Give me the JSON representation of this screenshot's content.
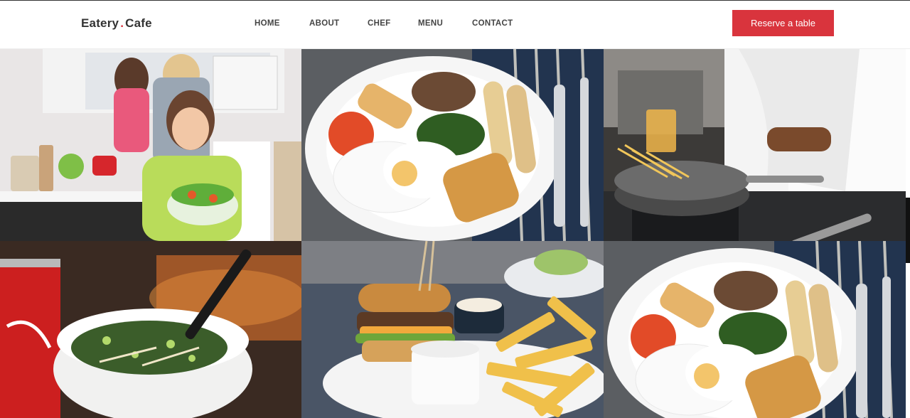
{
  "brand": {
    "name_part1": "Eatery",
    "separator": ".",
    "name_part2": "Cafe"
  },
  "nav": {
    "items": [
      {
        "label": "HOME"
      },
      {
        "label": "ABOUT"
      },
      {
        "label": "CHEF"
      },
      {
        "label": "MENU"
      },
      {
        "label": "CONTACT"
      }
    ],
    "reserve_label": "Reserve a table"
  },
  "colors": {
    "accent": "#d9343d",
    "nav_text": "#444444",
    "brand_text": "#333333"
  },
  "gallery": {
    "tiles": [
      {
        "subject": "family-kitchen-salad"
      },
      {
        "subject": "breakfast-plate"
      },
      {
        "subject": "chef-cooking-pasta"
      },
      {
        "subject": "noodle-soup-bowl-cola"
      },
      {
        "subject": "burger-and-fries"
      },
      {
        "subject": "breakfast-plate"
      }
    ]
  }
}
